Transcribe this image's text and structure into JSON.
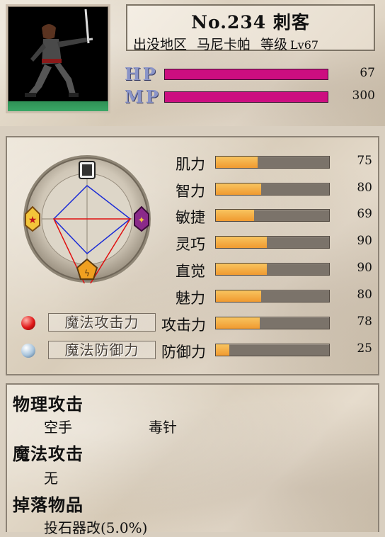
{
  "monster": {
    "name_line": "No.234 刺客",
    "area_label": "出没地区",
    "area_value": "马尼卡帕",
    "level_label": "等级",
    "level_value": "Lv67"
  },
  "vitals": [
    {
      "label": "HP",
      "value": "67",
      "fraction": 1.0,
      "color": "#cc0e80"
    },
    {
      "label": "MP",
      "value": "300",
      "fraction": 1.0,
      "color": "#cc0e80"
    }
  ],
  "stats": [
    {
      "label": "肌力",
      "value": "75",
      "fraction": 0.37
    },
    {
      "label": "智力",
      "value": "80",
      "fraction": 0.4
    },
    {
      "label": "敏捷",
      "value": "69",
      "fraction": 0.34
    },
    {
      "label": "灵巧",
      "value": "90",
      "fraction": 0.45
    },
    {
      "label": "直觉",
      "value": "90",
      "fraction": 0.45
    },
    {
      "label": "魅力",
      "value": "80",
      "fraction": 0.4
    },
    {
      "label": "攻击力",
      "value": "78",
      "fraction": 0.39
    },
    {
      "label": "防御力",
      "value": "25",
      "fraction": 0.12
    }
  ],
  "attack_types": [
    {
      "label": "魔法攻击力",
      "orb": "red-orb-icon"
    },
    {
      "label": "魔法防御力",
      "orb": "blue-orb-icon"
    }
  ],
  "colors": {
    "bar_fill": "#f5a23a",
    "bar_track": "#7b736a",
    "vital_fill": "#cc0e80",
    "radar_blue": "#1a2bd6",
    "radar_red": "#e01010"
  },
  "element_icons": [
    "top-element-icon",
    "left-element-icon",
    "right-element-icon",
    "bottom-element-icon"
  ],
  "sections": {
    "physical_title": "物理攻击",
    "physical_items": [
      "空手",
      "毒针"
    ],
    "magic_title": "魔法攻击",
    "magic_items": [
      "无"
    ],
    "drops_title": "掉落物品",
    "drops_items": [
      "投石器改(5.0%)"
    ]
  }
}
